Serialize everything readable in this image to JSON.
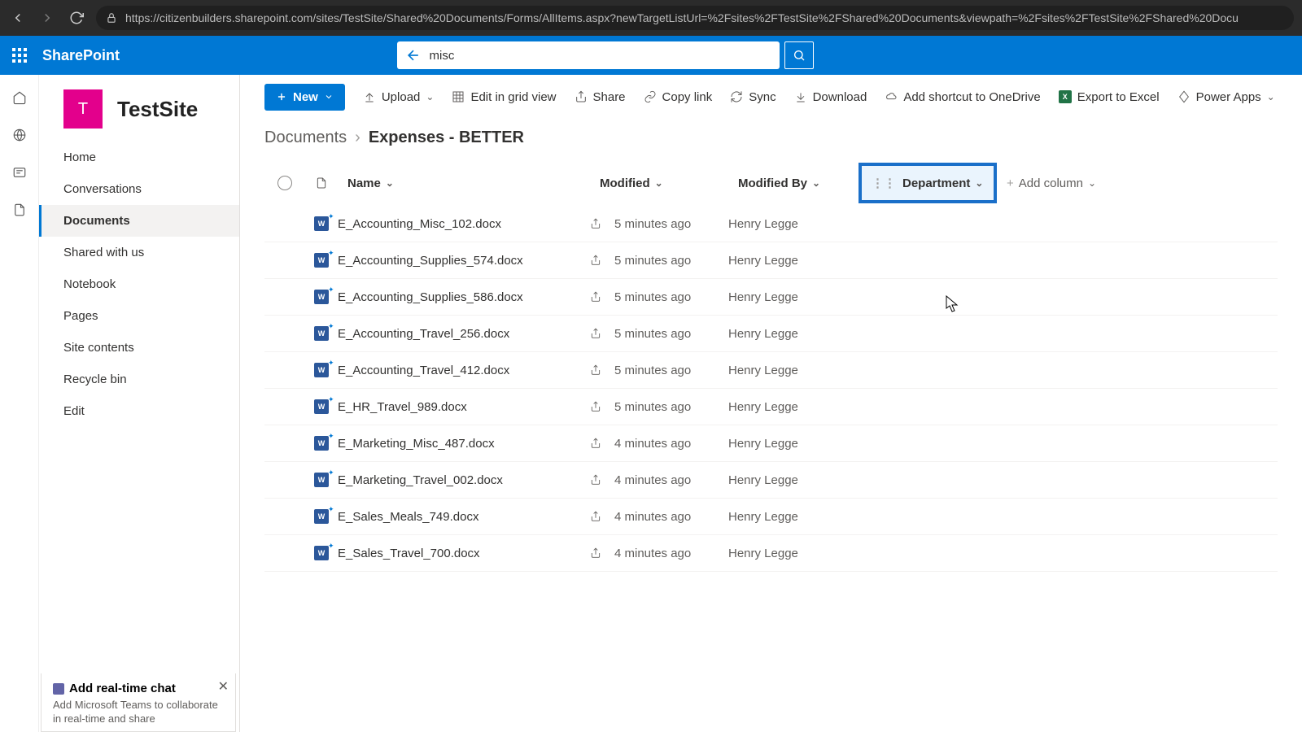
{
  "browser": {
    "url": "https://citizenbuilders.sharepoint.com/sites/TestSite/Shared%20Documents/Forms/AllItems.aspx?newTargetListUrl=%2Fsites%2FTestSite%2FShared%20Documents&viewpath=%2Fsites%2FTestSite%2FShared%20Docu"
  },
  "suite": {
    "title": "SharePoint",
    "search_value": "misc"
  },
  "site": {
    "logo_letter": "T",
    "name": "TestSite"
  },
  "sidenav": [
    "Home",
    "Conversations",
    "Documents",
    "Shared with us",
    "Notebook",
    "Pages",
    "Site contents",
    "Recycle bin",
    "Edit"
  ],
  "sidenav_selected": 2,
  "toolbar": {
    "new": "New",
    "upload": "Upload",
    "edit_grid": "Edit in grid view",
    "share": "Share",
    "copy_link": "Copy link",
    "sync": "Sync",
    "download": "Download",
    "shortcut": "Add shortcut to OneDrive",
    "export": "Export to Excel",
    "power_apps": "Power Apps"
  },
  "breadcrumb": {
    "root": "Documents",
    "current": "Expenses - BETTER"
  },
  "columns": {
    "name": "Name",
    "modified": "Modified",
    "by": "Modified By",
    "dept": "Department",
    "add": "Add column"
  },
  "rows": [
    {
      "name": "E_Accounting_Misc_102.docx",
      "mod": "5 minutes ago",
      "by": "Henry Legge"
    },
    {
      "name": "E_Accounting_Supplies_574.docx",
      "mod": "5 minutes ago",
      "by": "Henry Legge"
    },
    {
      "name": "E_Accounting_Supplies_586.docx",
      "mod": "5 minutes ago",
      "by": "Henry Legge"
    },
    {
      "name": "E_Accounting_Travel_256.docx",
      "mod": "5 minutes ago",
      "by": "Henry Legge"
    },
    {
      "name": "E_Accounting_Travel_412.docx",
      "mod": "5 minutes ago",
      "by": "Henry Legge"
    },
    {
      "name": "E_HR_Travel_989.docx",
      "mod": "5 minutes ago",
      "by": "Henry Legge"
    },
    {
      "name": "E_Marketing_Misc_487.docx",
      "mod": "4 minutes ago",
      "by": "Henry Legge"
    },
    {
      "name": "E_Marketing_Travel_002.docx",
      "mod": "4 minutes ago",
      "by": "Henry Legge"
    },
    {
      "name": "E_Sales_Meals_749.docx",
      "mod": "4 minutes ago",
      "by": "Henry Legge"
    },
    {
      "name": "E_Sales_Travel_700.docx",
      "mod": "4 minutes ago",
      "by": "Henry Legge"
    }
  ],
  "chat": {
    "title": "Add real-time chat",
    "sub": "Add Microsoft Teams to collaborate in real-time and share"
  }
}
